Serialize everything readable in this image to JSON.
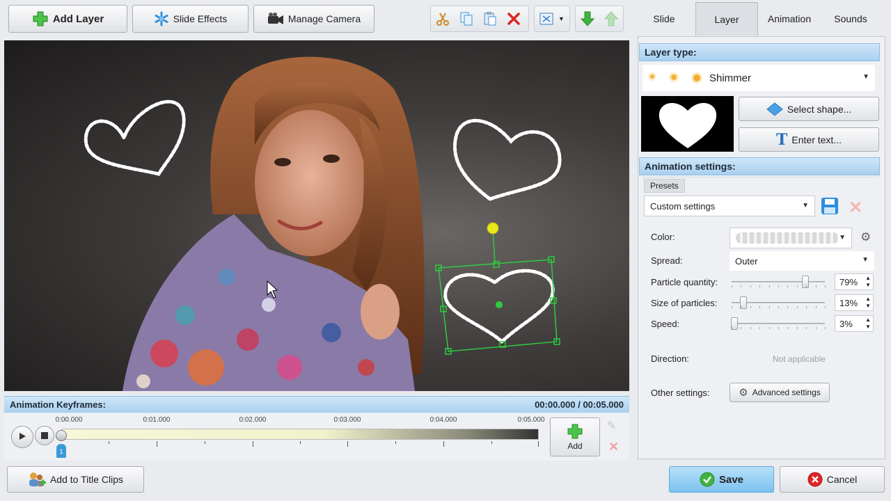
{
  "toolbar": {
    "add_layer": "Add Layer",
    "slide_effects": "Slide Effects",
    "manage_camera": "Manage Camera"
  },
  "keyframes": {
    "title": "Animation Keyframes:",
    "time": "00:00.000 / 00:05.000",
    "ticks": [
      "0:00.000",
      "0:01.000",
      "0:02.000",
      "0:03.000",
      "0:04.000",
      "0:05.000"
    ],
    "marker_label": "1",
    "add_label": "Add"
  },
  "tabs": [
    "Slide",
    "Layer",
    "Animation",
    "Sounds"
  ],
  "layer_type": {
    "header": "Layer type:",
    "value": "Shimmer",
    "select_shape": "Select shape...",
    "enter_text": "Enter text..."
  },
  "animation": {
    "header": "Animation settings:",
    "presets_label": "Presets",
    "preset_value": "Custom settings",
    "color_label": "Color:",
    "spread_label": "Spread:",
    "spread_value": "Outer",
    "particle_quantity_label": "Particle quantity:",
    "particle_quantity_value": "79%",
    "size_label": "Size of particles:",
    "size_value": "13%",
    "speed_label": "Speed:",
    "speed_value": "3%",
    "direction_label": "Direction:",
    "direction_value": "Not applicable",
    "other_label": "Other settings:",
    "advanced_button": "Advanced settings"
  },
  "levels": {
    "particle_quantity": 0.79,
    "size": 0.13,
    "speed": 0.03
  },
  "bottom": {
    "add_to_title_clips": "Add to Title Clips",
    "save": "Save",
    "cancel": "Cancel"
  },
  "colors": {
    "accent_blue": "#a9d0ef",
    "selection_green": "#2ecc40",
    "handle_yellow": "#e8e81c",
    "save_bg": "#8fcdf2"
  }
}
